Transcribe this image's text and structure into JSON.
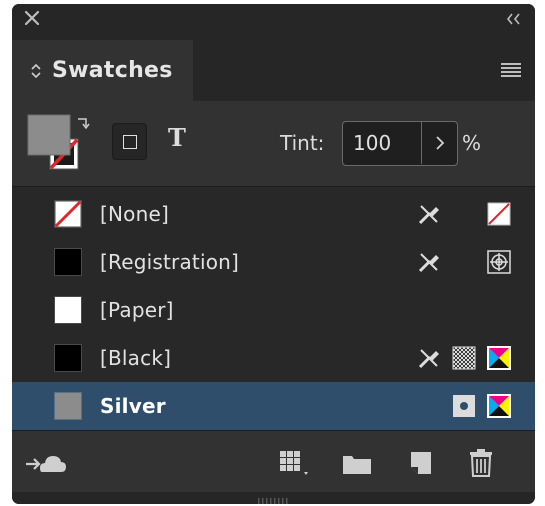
{
  "panel": {
    "title": "Swatches"
  },
  "tint": {
    "label": "Tint:",
    "value": "100",
    "unit": "%"
  },
  "type_toggle": "T",
  "swatches": [
    {
      "label": "[None]",
      "color": "#ffffff",
      "selected": false,
      "icons": [
        "no-edit-icon",
        "none-swatch-icon"
      ]
    },
    {
      "label": "[Registration]",
      "color": "#000000",
      "selected": false,
      "icons": [
        "no-edit-icon",
        "registration-mark-icon"
      ]
    },
    {
      "label": "[Paper]",
      "color": "#ffffff",
      "selected": false,
      "icons": []
    },
    {
      "label": "[Black]",
      "color": "#000000",
      "selected": false,
      "icons": [
        "no-edit-icon",
        "process-checker-icon",
        "cmyk-icon"
      ]
    },
    {
      "label": "Silver",
      "color": "#8c8c8c",
      "selected": true,
      "icons": [
        "spot-color-icon",
        "cmyk-icon"
      ]
    }
  ],
  "colors": {
    "panel_bg": "#323232",
    "selected_row": "#2f4e6c",
    "fill_swatch": "#8c8c8c",
    "none_red": "#e0262a"
  }
}
